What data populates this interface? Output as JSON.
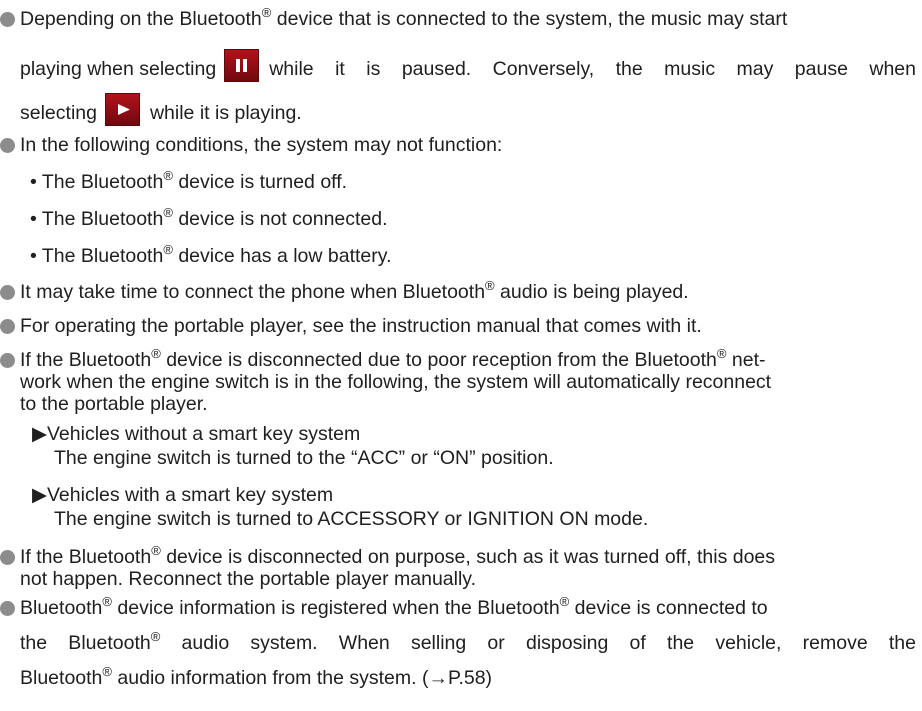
{
  "reg": "®",
  "b1": {
    "l1a": "Depending on the Bluetooth",
    "l1b": " device that is connected to the system, the music may start",
    "l2a": "playing when selecting",
    "l2b": "while it is paused. Conversely, the music may pause when",
    "l3a": "selecting",
    "l3b": "while it is playing.",
    "pause_icon": "pause-icon",
    "play_icon": "play-icon"
  },
  "b2": {
    "text": "In the following conditions, the system may not function:",
    "s1a": "• The Bluetooth",
    "s1b": " device is turned off.",
    "s2a": "• The Bluetooth",
    "s2b": " device is not connected.",
    "s3a": "• The Bluetooth",
    "s3b": " device has a low battery."
  },
  "b3": {
    "a": "It may take time to connect the phone when Bluetooth",
    "b": " audio is being played."
  },
  "b4": {
    "text": "For operating the portable player, see the instruction manual that comes with it."
  },
  "b5": {
    "a": "If the Bluetooth",
    "b": " device is disconnected due to poor reception from the Bluetooth",
    "c": " net-",
    "l2": "work when the engine switch is in the following, the system will automatically reconnect",
    "l3": "to the portable player.",
    "v1_head": "▶Vehicles without a smart key system",
    "v1_body": "The engine switch is turned to the “ACC” or “ON” position.",
    "v2_head": "▶Vehicles with a smart key system",
    "v2_body": "The engine switch is turned to ACCESSORY or IGNITION ON mode."
  },
  "b6": {
    "a": "If the Bluetooth",
    "b": " device is disconnected on purpose, such as it was turned off, this does",
    "l2": "not happen. Reconnect the portable player manually."
  },
  "b7": {
    "l1a": "Bluetooth",
    "l1b": " device information is registered when the Bluetooth",
    "l1c": " device is connected to",
    "l2a": "the Bluetooth",
    "l2b": " audio system. When selling or disposing of the vehicle, remove the",
    "l3a": "Bluetooth",
    "l3b": " audio information from the system. (→P.58)"
  }
}
